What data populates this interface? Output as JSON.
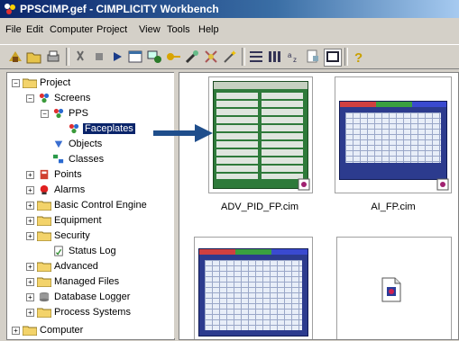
{
  "window": {
    "title": "PPSCIMP.gef - CIMPLICITY Workbench"
  },
  "menu": [
    "File",
    "Edit",
    "Computer",
    "Project",
    "View",
    "Tools",
    "Help"
  ],
  "tree": {
    "project": "Project",
    "screens": "Screens",
    "pps": "PPS",
    "faceplates": "Faceplates",
    "objects": "Objects",
    "classes": "Classes",
    "points": "Points",
    "alarms": "Alarms",
    "bce": "Basic Control Engine",
    "equipment": "Equipment",
    "security": "Security",
    "status_log": "Status Log",
    "advanced": "Advanced",
    "managed_files": "Managed Files",
    "db_logger": "Database Logger",
    "process_systems": "Process Systems",
    "computer": "Computer"
  },
  "files": [
    {
      "name": "ADV_PID_FP.cim"
    },
    {
      "name": "AI_FP.cim"
    },
    {
      "name": ""
    },
    {
      "name": ""
    }
  ],
  "icons": {
    "app": "cimplicity-app-icon",
    "folder": "folder-icon",
    "screen": "screen-icon"
  },
  "colors": {
    "title_start": "#0a246a",
    "selection": "#0a246a",
    "arrow": "#1f4e8c"
  }
}
